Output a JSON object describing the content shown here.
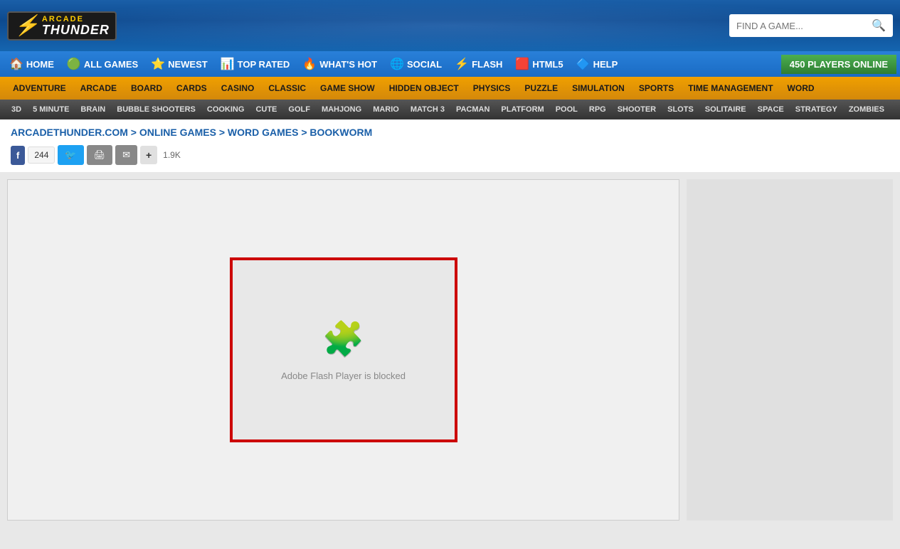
{
  "header": {
    "logo": {
      "bolt": "⚡",
      "arcade": "ARCADE",
      "thunder": "THUNDER"
    },
    "search": {
      "placeholder": "FIND A GAME..."
    }
  },
  "nav": {
    "items": [
      {
        "id": "home",
        "label": "HOME",
        "icon": "🏠"
      },
      {
        "id": "all-games",
        "label": "ALL GAMES",
        "icon": "🟢"
      },
      {
        "id": "newest",
        "label": "NEWEST",
        "icon": "⭐"
      },
      {
        "id": "top-rated",
        "label": "TOP RATED",
        "icon": "📊"
      },
      {
        "id": "whats-hot",
        "label": "WHAT'S HOT",
        "icon": "🔥"
      },
      {
        "id": "social",
        "label": "SOCIAL",
        "icon": "🌐"
      },
      {
        "id": "flash",
        "label": "FLASH",
        "icon": "⚡"
      },
      {
        "id": "html5",
        "label": "HTML5",
        "icon": "🟥"
      },
      {
        "id": "help",
        "label": "HELP",
        "icon": "🔷"
      }
    ],
    "players_online": "450 PLAYERS ONLINE"
  },
  "categories": [
    "ADVENTURE",
    "ARCADE",
    "BOARD",
    "CARDS",
    "CASINO",
    "CLASSIC",
    "GAME SHOW",
    "HIDDEN OBJECT",
    "PHYSICS",
    "PUZZLE",
    "SIMULATION",
    "SPORTS",
    "TIME MANAGEMENT",
    "WORD"
  ],
  "subcategories": [
    "3D",
    "5 MINUTE",
    "BRAIN",
    "BUBBLE SHOOTERS",
    "COOKING",
    "CUTE",
    "GOLF",
    "MAHJONG",
    "MARIO",
    "MATCH 3",
    "PACMAN",
    "PLATFORM",
    "POOL",
    "RPG",
    "SHOOTER",
    "SLOTS",
    "SOLITAIRE",
    "SPACE",
    "STRATEGY",
    "ZOMBIES"
  ],
  "breadcrumb": "ARCADETHUNDER.COM > ONLINE GAMES > WORD GAMES > BOOKWORM",
  "social": {
    "fb_count": "244",
    "share_count": "1.9K"
  },
  "game": {
    "flash_blocked_text": "Adobe Flash Player is blocked",
    "puzzle_icon": "🧩"
  }
}
